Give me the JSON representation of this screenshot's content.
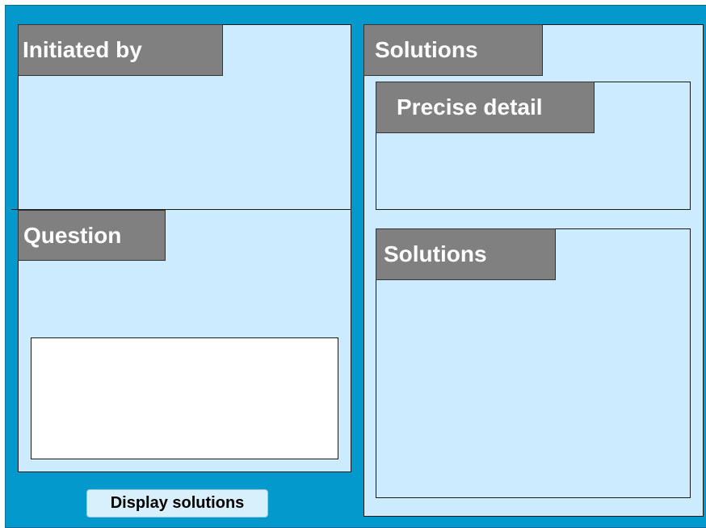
{
  "left_panel": {
    "initiated_by_label": "Initiated by",
    "question_label": "Question"
  },
  "right_panel": {
    "title": "Solutions",
    "precise_detail_label": "Precise detail",
    "solutions_label": "Solutions"
  },
  "actions": {
    "display_solutions_label": "Display solutions"
  },
  "colors": {
    "background": "#0399cd",
    "panel": "#cdebfe",
    "header": "#808080"
  }
}
